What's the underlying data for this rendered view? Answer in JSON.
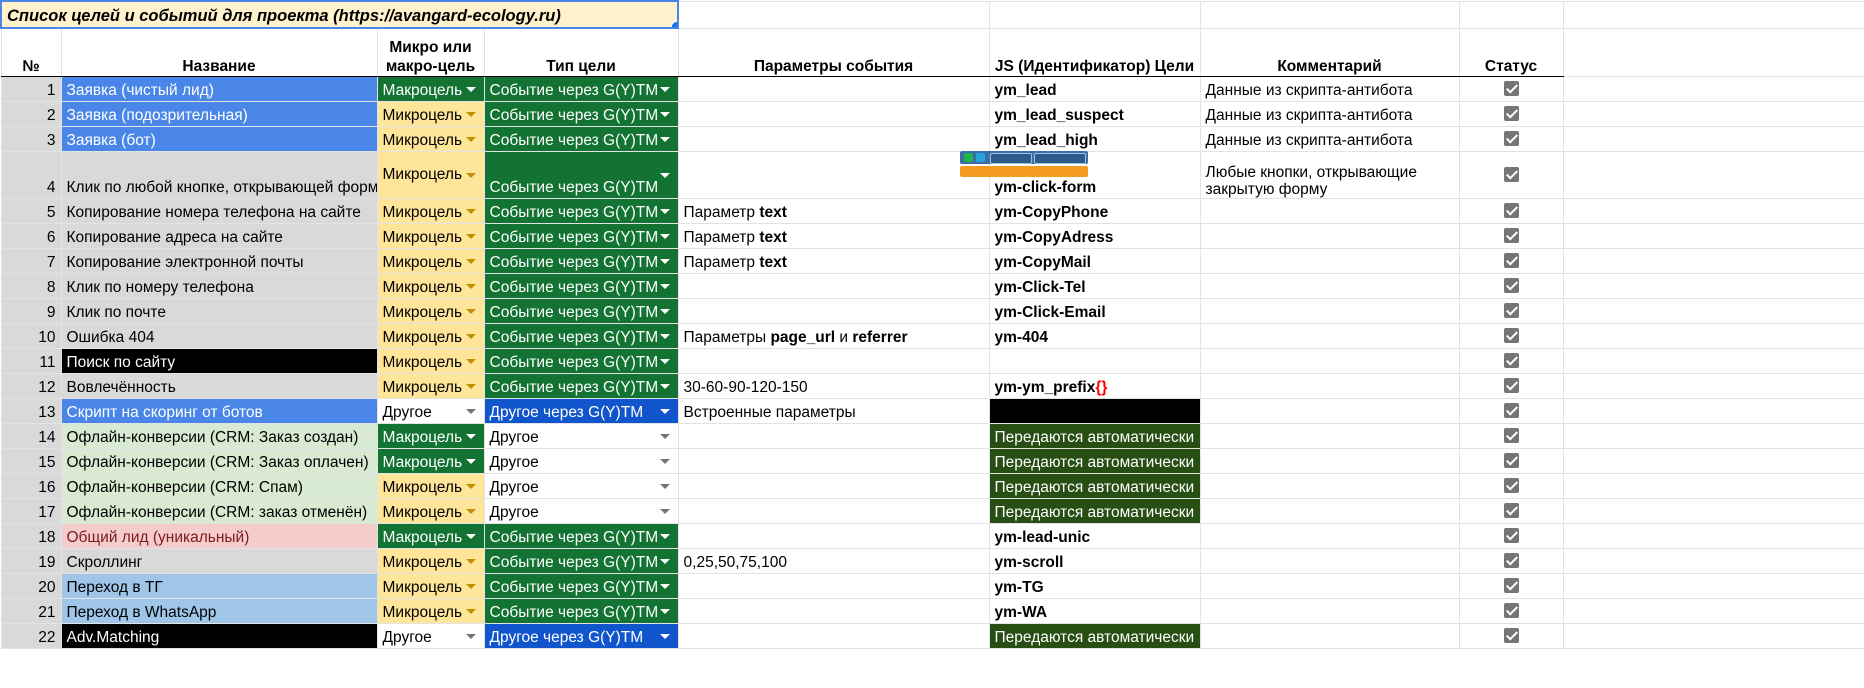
{
  "title": "Список целей и событий для проекта (https://avangard-ecology.ru)",
  "headers": {
    "num": "№",
    "name": "Название",
    "type": "Микро или макро-цель",
    "goal": "Тип цели",
    "params": "Параметры события",
    "js": "JS (Идентификатор) Цели",
    "comment": "Комментарий",
    "status": "Статус"
  },
  "rows": [
    {
      "n": "1",
      "name": "Заявка (чистый лид)",
      "type": "Макроцель",
      "goal": "Событие через G(Y)TM",
      "params": "",
      "js": "ym_lead",
      "comment": "Данные из скрипта-антибота",
      "checked": true
    },
    {
      "n": "2",
      "name": "Заявка (подозрительная)",
      "type": "Микроцель",
      "goal": "Событие через G(Y)TM",
      "params": "",
      "js": "ym_lead_suspect",
      "comment": "Данные из скрипта-антибота",
      "checked": true
    },
    {
      "n": "3",
      "name": "Заявка (бот)",
      "type": "Микроцель",
      "goal": "Событие через G(Y)TM",
      "params": "",
      "js": "ym_lead_high",
      "comment": "Данные из скрипта-антибота",
      "checked": true
    },
    {
      "n": "4",
      "name": "Клик по любой кнопке, открывающей форму",
      "type": "Микроцель",
      "goal": "Событие через G(Y)TM",
      "params": "",
      "js": "ym-click-form",
      "comment": "Любые кнопки, открывающие закрытую форму",
      "checked": true
    },
    {
      "n": "5",
      "name": "Копирование номера телефона на сайте",
      "type": "Микроцель",
      "goal": "Событие через G(Y)TM",
      "params_pre": "Параметр ",
      "params_b": "text",
      "js": "ym-CopyPhone",
      "comment": "",
      "checked": true
    },
    {
      "n": "6",
      "name": "Копирование адреса на сайте",
      "type": "Микроцель",
      "goal": "Событие через G(Y)TM",
      "params_pre": "Параметр ",
      "params_b": "text",
      "js": "ym-CopyAdress",
      "comment": "",
      "checked": true
    },
    {
      "n": "7",
      "name": "Копирование электронной почты",
      "type": "Микроцель",
      "goal": "Событие через G(Y)TM",
      "params_pre": "Параметр ",
      "params_b": "text",
      "js": "ym-CopyMail",
      "comment": "",
      "checked": true
    },
    {
      "n": "8",
      "name": "Клик по номеру телефона",
      "type": "Микроцель",
      "goal": "Событие через G(Y)TM",
      "params": "",
      "js": "ym-Click-Tel",
      "comment": "",
      "checked": true
    },
    {
      "n": "9",
      "name": "Клик по почте",
      "type": "Микроцель",
      "goal": "Событие через G(Y)TM",
      "params": "",
      "js": "ym-Click-Email",
      "comment": "",
      "checked": true
    },
    {
      "n": "10",
      "name": "Ошибка 404",
      "type": "Микроцель",
      "goal": "Событие через G(Y)TM",
      "params_pre": "Параметры ",
      "params_b": "page_url",
      "params_mid": " и ",
      "params_b2": "referrer",
      "js": "ym-404",
      "comment": "",
      "checked": true
    },
    {
      "n": "11",
      "name": "Поиск по сайту",
      "type": "Микроцель",
      "goal": "Событие через G(Y)TM",
      "params": "",
      "js": "",
      "comment": "",
      "checked": true
    },
    {
      "n": "12",
      "name": "Вовлечённость",
      "type": "Микроцель",
      "goal": "Событие через G(Y)TM",
      "params": "30-60-90-120-150",
      "js": "ym-ym_prefix",
      "js_suffix": "{}",
      "comment": "",
      "checked": true
    },
    {
      "n": "13",
      "name": "Скрипт на скоринг от ботов",
      "type": "Другое",
      "goal": "Другое через G(Y)TM",
      "params": "Встроенные параметры",
      "js": "",
      "comment": "",
      "checked": true
    },
    {
      "n": "14",
      "name": "Офлайн-конверсии (CRM: Заказ создан)",
      "type": "Макроцель",
      "goal": "Другое",
      "params": "",
      "js": "Передаются автоматически",
      "comment": "",
      "checked": true
    },
    {
      "n": "15",
      "name": "Офлайн-конверсии (CRM: Заказ оплачен)",
      "type": "Макроцель",
      "goal": "Другое",
      "params": "",
      "js": "Передаются автоматически",
      "comment": "",
      "checked": true
    },
    {
      "n": "16",
      "name": "Офлайн-конверсии (CRM: Спам)",
      "type": "Микроцель",
      "goal": "Другое",
      "params": "",
      "js": "Передаются автоматически",
      "comment": "",
      "checked": true
    },
    {
      "n": "17",
      "name": "Офлайн-конверсии (CRM: заказ отменён)",
      "type": "Микроцель",
      "goal": "Другое",
      "params": "",
      "js": "Передаются автоматически",
      "comment": "",
      "checked": true
    },
    {
      "n": "18",
      "name": "Общий лид (уникальный)",
      "type": "Макроцель",
      "goal": "Событие через G(Y)TM",
      "params": "",
      "js": "ym-lead-unic",
      "comment": "",
      "checked": true
    },
    {
      "n": "19",
      "name": "Скроллинг",
      "type": "Микроцель",
      "goal": "Событие через G(Y)TM",
      "params": "0,25,50,75,100",
      "js": "ym-scroll",
      "comment": "",
      "checked": true
    },
    {
      "n": "20",
      "name": "Переход в ТГ",
      "type": "Микроцель",
      "goal": "Событие через G(Y)TM",
      "params": "",
      "js": "ym-TG",
      "comment": "",
      "checked": true
    },
    {
      "n": "21",
      "name": "Переход в WhatsApp",
      "type": "Микроцель",
      "goal": "Событие через G(Y)TM",
      "params": "",
      "js": "ym-WA",
      "comment": "",
      "checked": true
    },
    {
      "n": "22",
      "name": "Adv.Matching",
      "type": "Другое",
      "goal": "Другое через G(Y)TM",
      "params": "",
      "js": "Передаются автоматически",
      "comment": "",
      "checked": true
    }
  ],
  "thumbnail": {
    "phone": "8 (800) 505-43-74",
    "email": "info@avangard-ecology.ru",
    "button": "Заказать звонок"
  },
  "colors": {
    "macro_green": "#137333",
    "micro_yellow": "#ffe599",
    "event_green": "#137333",
    "other_blue": "#1155cc",
    "auto_dark_green": "#274e13",
    "name_blue": "#4a86e8",
    "name_grey": "#d9d9d9",
    "name_green": "#d9ead3",
    "name_pink": "#f4cccc",
    "name_sky": "#9fc5e8"
  },
  "icons": {
    "checkbox": "checkbox-checked-icon",
    "dropdown": "dropdown-arrow-icon"
  }
}
